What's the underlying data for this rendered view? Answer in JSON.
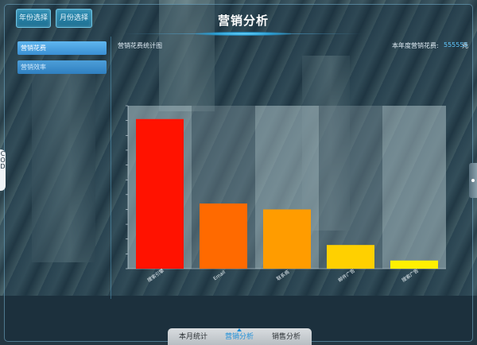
{
  "header": {
    "title": "营销分析",
    "year_button": "年份选择",
    "month_button": "月份选择"
  },
  "sidebar": {
    "items": [
      {
        "label": "营销花费",
        "active": true
      },
      {
        "label": "营销效率",
        "active": false
      }
    ]
  },
  "main": {
    "chart_title": "营销花费统计图",
    "year_total_label": "本年度营销花费:",
    "year_total_value": "555555",
    "year_total_unit": "元"
  },
  "edge_widget_text": "C\nO\nD",
  "bottom_nav": {
    "tabs": [
      {
        "label": "本月统计",
        "active": false
      },
      {
        "label": "营销分析",
        "active": true
      },
      {
        "label": "销售分析",
        "active": false
      }
    ]
  },
  "colors": {
    "accent": "#1e8fd8",
    "value_text": "#5fc8ff"
  },
  "chart_data": {
    "type": "bar",
    "categories": [
      "搜索引擎",
      "Email",
      "联系商",
      "邮件广告",
      "搜索广告"
    ],
    "values": [
      3020,
      1880,
      1800,
      1320,
      1110
    ],
    "bar_colors": [
      "#ff1200",
      "#ff6a00",
      "#ff9c00",
      "#ffd000",
      "#fff000"
    ],
    "ylim": [
      1000,
      3200
    ],
    "yticks": [
      "1,000",
      "1,200",
      "1,400",
      "1,600",
      "1,800",
      "2,000",
      "2,200",
      "2,400",
      "2,600",
      "2,800",
      "3,000",
      "3,200"
    ],
    "title": "",
    "xlabel": "",
    "ylabel": "",
    "grid": false,
    "legend": "none"
  }
}
